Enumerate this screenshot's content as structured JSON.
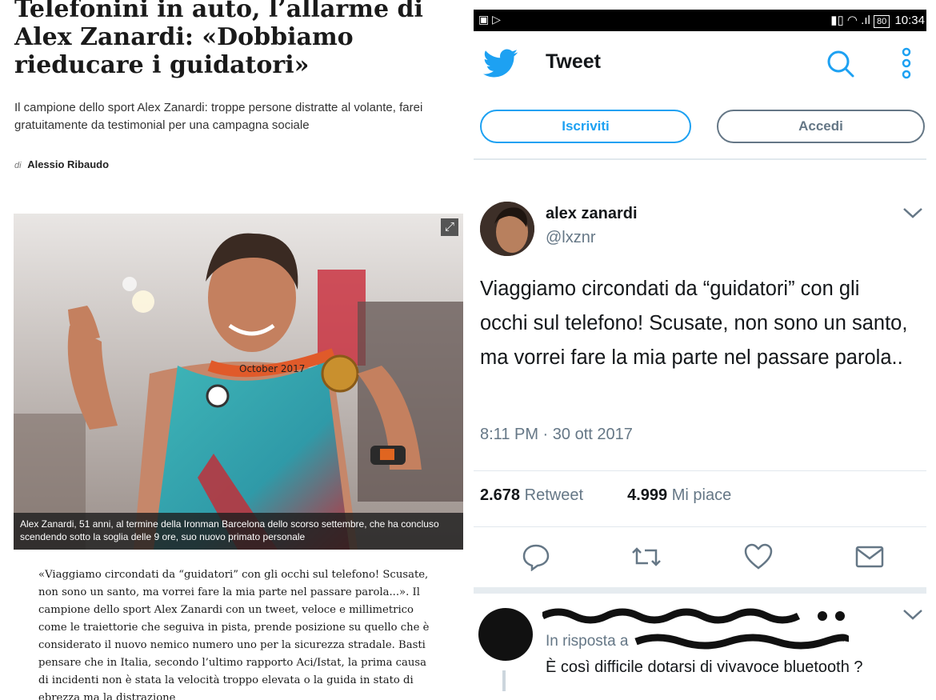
{
  "article": {
    "headline": "Telefonini in auto, l’allarme di Alex Zanardi: «Dobbiamo rieducare i guidatori»",
    "subtitle": "Il campione dello sport Alex Zanardi: troppe persone distratte al volante, farei gratuitamente da testimonial per una campagna sociale",
    "byline_prefix": "di",
    "author": "Alessio Ribaudo",
    "caption": "Alex Zanardi, 51 anni, al termine della Ironman Barcelona dello scorso settembre, che ha concluso scendendo sotto la soglia delle 9 ore, suo nuovo primato personale",
    "body": "«Viaggiamo circondati da “guidatori” con gli occhi sul telefono! Scusate, non sono un santo, ma vorrei fare la mia parte nel passare parola...». Il campione dello sport Alex Zanardi con un tweet, veloce e millimetrico come le traiettorie che seguiva in pista, prende posizione su quello che è considerato il nuovo nemico numero uno per la sicurezza stradale. Basti pensare che in Italia, secondo l’ultimo rapporto Aci/Istat, la prima causa di incidenti non è stata la velocità troppo elevata o la guida in stato di ebrezza ma la distrazione",
    "photo_text": "October 2017"
  },
  "twitter": {
    "status": {
      "battery": "80",
      "time": "10:34"
    },
    "header_title": "Tweet",
    "signup_label": "Iscriviti",
    "login_label": "Accedi",
    "tweet": {
      "name": "alex zanardi",
      "handle": "@lxznr",
      "text": "Viaggiamo circondati da “guidatori” con gli occhi sul telefono! Scusate, non sono un santo, ma vorrei fare la mia parte nel passare parola..",
      "time": "8:11 PM · 30 ott 2017",
      "retweets": "2.678",
      "retweets_label": "Retweet",
      "likes": "4.999",
      "likes_label": "Mi piace"
    },
    "reply": {
      "in_reply_prefix": "In risposta a",
      "text": "È così difficile dotarsi di vivavoce bluetooth ?"
    },
    "colors": {
      "accent": "#1da1f2",
      "muted": "#657786",
      "text": "#14171a"
    }
  }
}
